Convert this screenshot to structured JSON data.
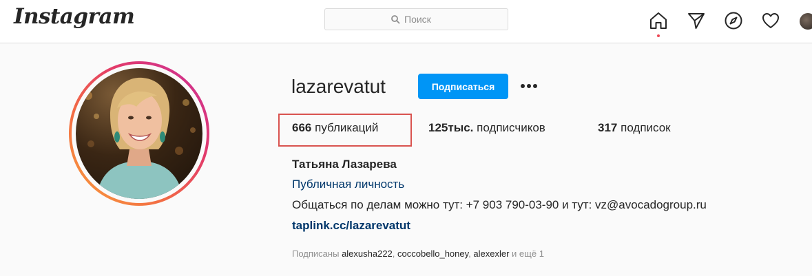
{
  "app": {
    "logo_text": "Instagram",
    "search_placeholder": "Поиск"
  },
  "nav": {
    "icons": [
      "home-icon",
      "direct-icon",
      "explore-icon",
      "activity-icon",
      "profile-avatar"
    ]
  },
  "profile": {
    "username": "lazarevatut",
    "follow_label": "Подписаться",
    "more_icon": "more-options-icon",
    "stats": {
      "posts_count": "666",
      "posts_label": "публикаций",
      "followers_count": "125тыс.",
      "followers_label": "подписчиков",
      "following_count": "317",
      "following_label": "подписок"
    },
    "full_name": "Татьяна Лазарева",
    "category": "Публичная личность",
    "bio": "Общаться по делам можно тут: +7 903 790-03-90 и тут: vz@avocadogroup.ru",
    "link": "taplink.cc/lazarevatut",
    "followed_by": {
      "prefix": "Подписаны",
      "user1": "alexusha222",
      "user2": "coccobello_honey",
      "user3": "alexexler",
      "suffix": "и ещё 1"
    }
  },
  "colors": {
    "accent": "#0095f6",
    "link": "#00376b",
    "highlight_box": "#d9534f",
    "notification_dot": "#ed4956"
  }
}
